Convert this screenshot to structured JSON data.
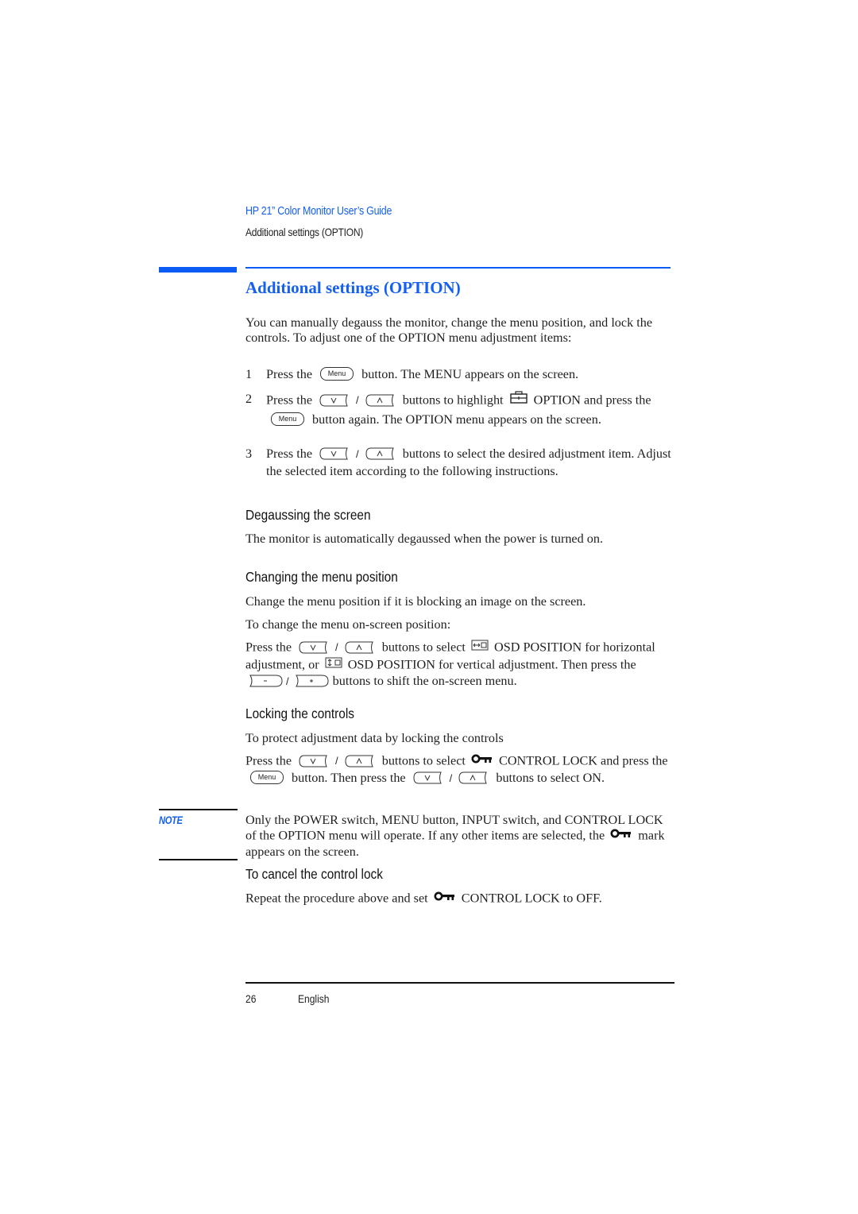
{
  "header": {
    "guide_title": "HP 21” Color Monitor User’s Guide",
    "section": "Additional settings (OPTION)"
  },
  "title": "Additional settings (OPTION)",
  "intro": "You can manually degauss the monitor, change the menu position, and lock the controls. To adjust one of the OPTION menu adjustment items:",
  "buttons": {
    "menu": "Menu",
    "down": "v",
    "up": "^",
    "minus": "-",
    "plus": "+",
    "separator": "/"
  },
  "steps": [
    {
      "num": "1",
      "pre": "Press the",
      "post": "button. The MENU appears on the screen."
    },
    {
      "num": "2",
      "pre": "Press the",
      "mid": "buttons to highlight",
      "icon": "toolbox-icon",
      "mid2": "OPTION and press the",
      "post": "button again. The OPTION menu appears on the screen."
    },
    {
      "num": "3",
      "pre": "Press the",
      "post": "buttons to select the desired adjustment item. Adjust the selected item according to the following instructions."
    }
  ],
  "degauss": {
    "heading": "Degaussing the screen",
    "text": "The monitor is automatically degaussed when the power is turned on."
  },
  "menu_position": {
    "heading": "Changing the menu position",
    "text1": "Change the menu position if it is blocking an image on the screen.",
    "text2": "To change the menu on-screen position:",
    "p_pre": "Press the",
    "p_mid": "buttons to select",
    "p_h": "OSD POSITION for horizontal adjustment, or",
    "p_v": "OSD POSITION for vertical adjustment. Then press the",
    "p_post": "buttons to shift the on-screen menu."
  },
  "locking": {
    "heading": "Locking the controls",
    "text1": "To protect adjustment data by locking the controls",
    "p_pre": "Press the",
    "p_mid": "buttons to select",
    "p_lock": "CONTROL LOCK and press the",
    "p_mid2": "button. Then press the",
    "p_post": "buttons to select ON."
  },
  "note": {
    "label": "NOTE",
    "pre": "Only the POWER switch, MENU button, INPUT switch, and CONTROL LOCK of the OPTION menu will operate. If any other items are selected, the",
    "post": "mark appears on the screen."
  },
  "cancel": {
    "heading": "To cancel the control lock",
    "pre": "Repeat the procedure above and set",
    "post": "CONTROL LOCK to OFF."
  },
  "footer": {
    "page": "26",
    "language": "English"
  },
  "colors": {
    "accent": "#1560f0",
    "rule": "#0a5cf5"
  }
}
